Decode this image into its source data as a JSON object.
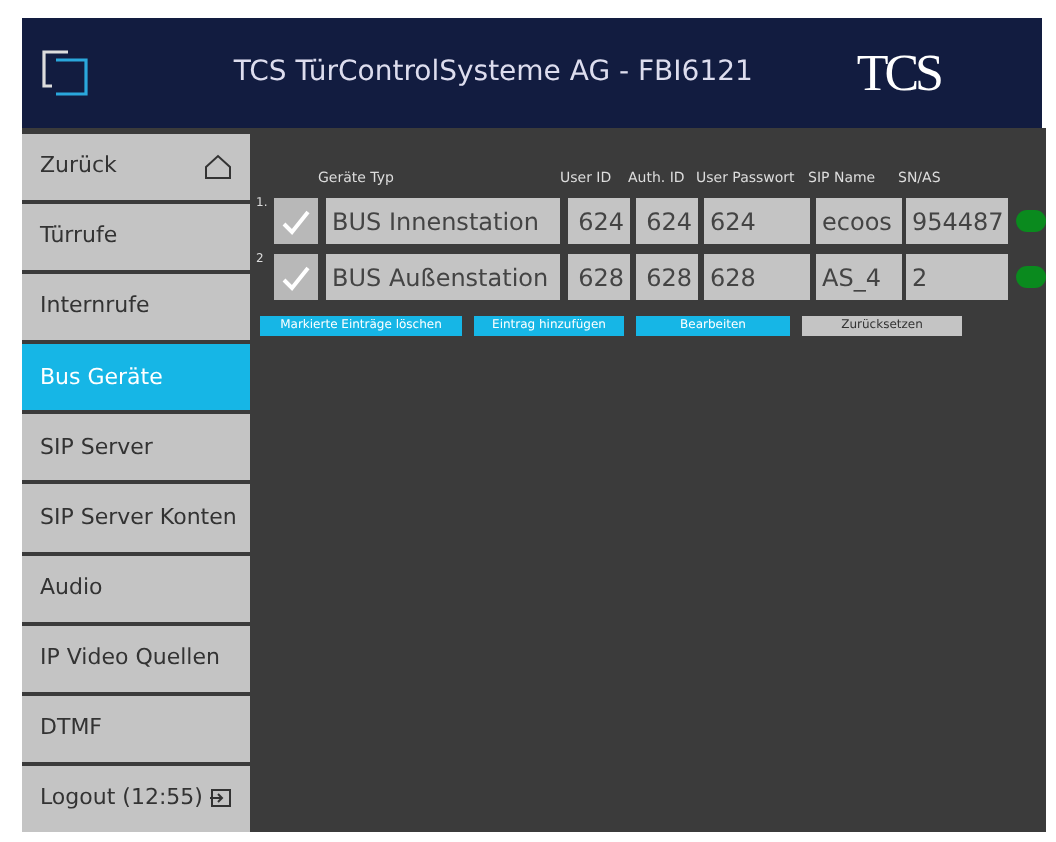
{
  "header": {
    "title": "TCS TürControlSysteme AG - FBI6121",
    "logo": "TCS"
  },
  "sidebar": {
    "items": [
      {
        "label": "Zurück",
        "kind": "home",
        "selected": false
      },
      {
        "label": "Türrufe",
        "kind": "plain",
        "selected": false
      },
      {
        "label": "Internrufe",
        "kind": "plain",
        "selected": false
      },
      {
        "label": "Bus Geräte",
        "kind": "plain",
        "selected": true
      },
      {
        "label": "SIP Server",
        "kind": "plain",
        "selected": false
      },
      {
        "label": "SIP Server Konten",
        "kind": "plain",
        "selected": false
      },
      {
        "label": "Audio",
        "kind": "plain",
        "selected": false
      },
      {
        "label": "IP Video Quellen",
        "kind": "plain",
        "selected": false
      },
      {
        "label": "DTMF",
        "kind": "plain",
        "selected": false
      },
      {
        "label": "Logout (12:55)",
        "kind": "logout",
        "selected": false
      }
    ]
  },
  "table": {
    "columns": [
      "Geräte Typ",
      "User ID",
      "Auth. ID",
      "User Passwort",
      "SIP Name",
      "SN/AS"
    ],
    "rows": [
      {
        "number": "1.",
        "checked": true,
        "cells": [
          "BUS Innenstation",
          "624",
          "624",
          "624",
          "ecoos",
          "954487"
        ],
        "color": "#0a8a1e"
      },
      {
        "number": "2",
        "checked": true,
        "cells": [
          "BUS Außenstation",
          "628",
          "628",
          "628",
          "AS_4",
          "2"
        ],
        "color": "#0a8a1e"
      }
    ]
  },
  "buttons": [
    {
      "label": "Markierte Einträge löschen",
      "kind": "primary"
    },
    {
      "label": "Eintrag hinzufügen",
      "kind": "primary"
    },
    {
      "label": "Bearbeiten",
      "kind": "primary"
    },
    {
      "label": "Zurücksetzen",
      "kind": "secondary"
    }
  ]
}
